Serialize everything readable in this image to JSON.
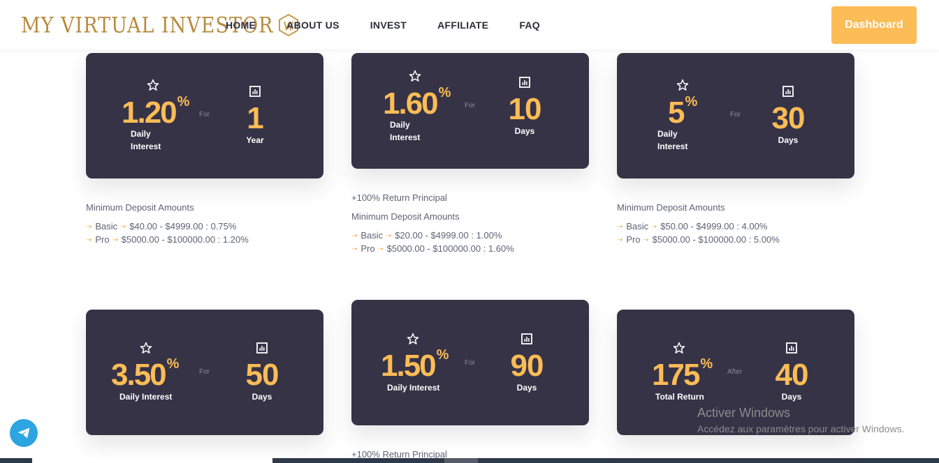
{
  "header": {
    "logo_text": "MY VIRTUAL INVESTOR",
    "nav": [
      "HOME",
      "ABOUT US",
      "INVEST",
      "AFFILIATE",
      "FAQ"
    ],
    "dashboard_label": "Dashboard"
  },
  "colors": {
    "accent": "#fcbc56",
    "card_bg": "#363347",
    "text_muted": "#5f6274",
    "telegram": "#2ca5e0"
  },
  "min_deposit_title": "Minimum Deposit Amounts",
  "return_principal": "+100% Return Principal",
  "plans": [
    {
      "rate": "1.20",
      "pct": "%",
      "label": "Daily",
      "label2": "Interest",
      "conj": "For",
      "duration": "1",
      "unit": "Year",
      "tiers": [
        {
          "name": "Basic",
          "range": "$40.00 - $4999.00 : 0.75%"
        },
        {
          "name": "Pro",
          "range": "$5000.00 - $100000.00 : 1.20%"
        }
      ]
    },
    {
      "rate": "1.60",
      "pct": "%",
      "label": "Daily",
      "label2": "Interest",
      "conj": "For",
      "duration": "10",
      "unit": "Days",
      "tiers": [
        {
          "name": "Basic",
          "range": "$20.00 - $4999.00 : 1.00%"
        },
        {
          "name": "Pro",
          "range": "$5000.00 - $100000.00 : 1.60%"
        }
      ]
    },
    {
      "rate": "5",
      "pct": "%",
      "label": "Daily",
      "label2": "Interest",
      "conj": "For",
      "duration": "30",
      "unit": "Days",
      "tiers": [
        {
          "name": "Basic",
          "range": "$50.00 - $4999.00 : 4.00%"
        },
        {
          "name": "Pro",
          "range": "$5000.00 - $100000.00 : 5.00%"
        }
      ]
    },
    {
      "rate": "3.50",
      "pct": "%",
      "label": "Daily Interest",
      "conj": "For",
      "duration": "50",
      "unit": "Days"
    },
    {
      "rate": "1.50",
      "pct": "%",
      "label": "Daily Interest",
      "conj": "For",
      "duration": "90",
      "unit": "Days"
    },
    {
      "rate": "175",
      "pct": "%",
      "label": "Total Return",
      "conj": "After",
      "duration": "40",
      "unit": "Days"
    }
  ],
  "windows_notice": {
    "title": "Activer Windows",
    "subtitle": "Accédez aux paramètres pour activer Windows."
  }
}
